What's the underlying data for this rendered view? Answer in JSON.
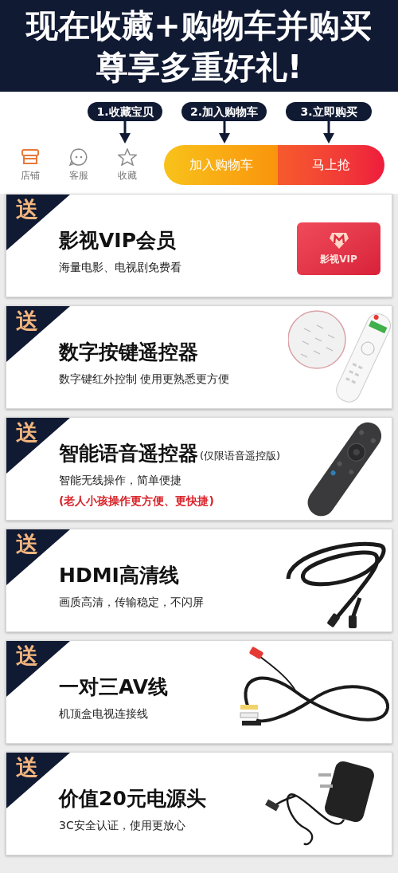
{
  "header": {
    "lines": [
      "现在收藏+购物车并购买",
      "尊享多重好礼!"
    ]
  },
  "steps": [
    {
      "label": "1.收藏宝贝"
    },
    {
      "label": "2.加入购物车"
    },
    {
      "label": "3.立即购买"
    }
  ],
  "nav_icons": [
    {
      "label": "店铺",
      "kind": "store",
      "color": "#e8793a"
    },
    {
      "label": "客服",
      "kind": "chat",
      "color": "#8a8a8a"
    },
    {
      "label": "收藏",
      "kind": "star",
      "color": "#8a8a8a"
    }
  ],
  "buttons": [
    {
      "label": "加入购物车",
      "kind": "cart"
    },
    {
      "label": "马上抢",
      "kind": "buy"
    }
  ],
  "gifts": [
    {
      "badge": "送",
      "title": "影视VIP会员",
      "lines": [
        {
          "text": "海量电影、电视剧免费看",
          "kind": "normal"
        }
      ],
      "kind": "vip-card",
      "picture_label": "影视VIP"
    },
    {
      "badge": "送",
      "title": "数字按键遥控器",
      "lines": [
        {
          "text": "数字键红外控制 使用更熟悉更方便",
          "kind": "normal"
        }
      ],
      "kind": "numeric-remote"
    },
    {
      "badge": "送",
      "title": "智能语音遥控器",
      "title_note": "(仅限语音遥控版)",
      "lines": [
        {
          "text": "智能无线操作，简单便捷",
          "kind": "normal"
        },
        {
          "text": "(老人小孩操作更方便、更快捷)",
          "kind": "highlight"
        }
      ],
      "kind": "voice-remote"
    },
    {
      "badge": "送",
      "title": "HDMI高清线",
      "lines": [
        {
          "text": "画质高清，传输稳定，不闪屏",
          "kind": "normal"
        }
      ],
      "kind": "hdmi-cable"
    },
    {
      "badge": "送",
      "title": "一对三AV线",
      "lines": [
        {
          "text": "机顶盒电视连接线",
          "kind": "normal"
        }
      ],
      "kind": "av-cable"
    },
    {
      "badge": "送",
      "title": "价值20元电源头",
      "lines": [
        {
          "text": "3C安全认证，使用更放心",
          "kind": "normal"
        }
      ],
      "kind": "power-adapter"
    }
  ]
}
